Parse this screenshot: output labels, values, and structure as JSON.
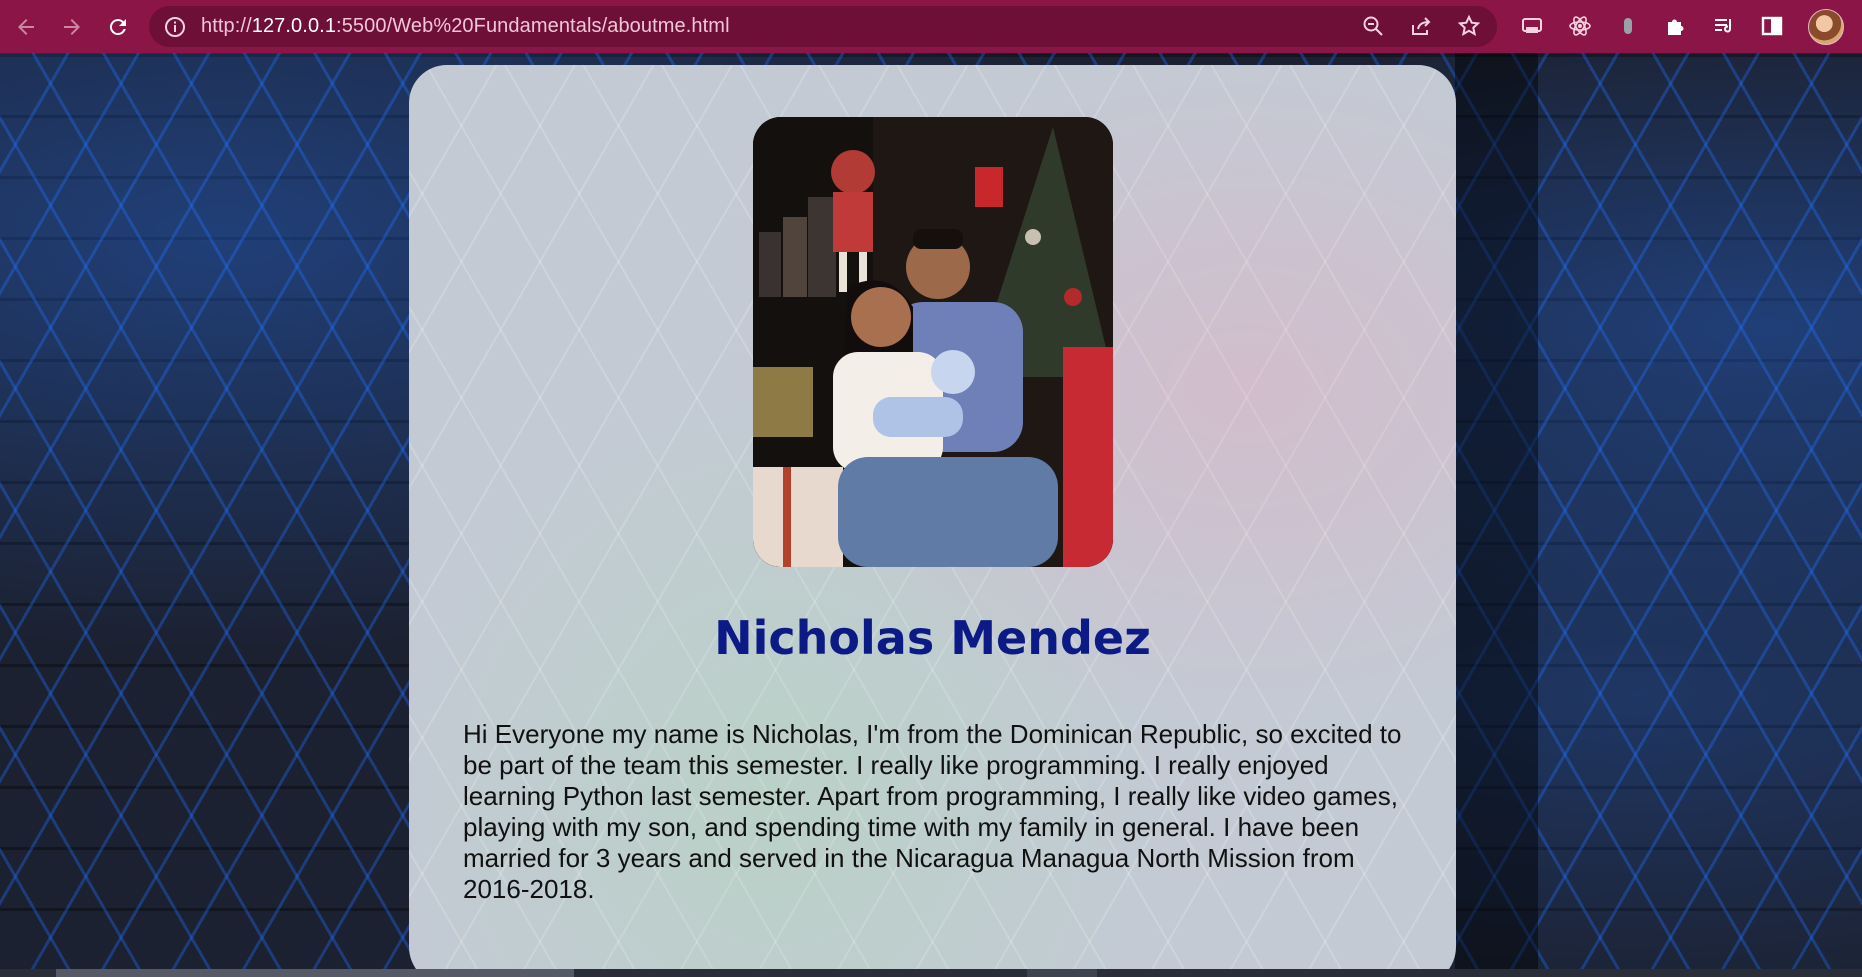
{
  "browser": {
    "url_prefix": "http://",
    "url_host": "127.0.0.1",
    "url_rest": ":5500/Web%20Fundamentals/aboutme.html",
    "icons": {
      "back": "arrow-left-icon",
      "forward": "arrow-right-icon",
      "reload": "reload-icon",
      "site_info": "info-icon",
      "zoom": "zoom-icon",
      "share": "share-icon",
      "bookmark": "star-icon",
      "extensions": [
        "cast-icon",
        "react-devtools-icon",
        "extension-icon",
        "puzzle-icon",
        "media-queue-icon",
        "side-panel-icon"
      ],
      "profile": "avatar"
    },
    "theme_color": "#8a1546"
  },
  "page": {
    "photo_alt": "Family photo",
    "name": "Nicholas Mendez",
    "name_color": "#0c1a86",
    "bio": "Hi Everyone my name is Nicholas, I'm from the Dominican Republic, so excited to be part of the team this semester. I really like programming. I really enjoyed learning Python last semester. Apart from programming, I really like video games, playing with my son, and spending time with my family in general. I have been married for 3 years and served in the Nicaragua Managua North Mission from 2016-2018."
  }
}
